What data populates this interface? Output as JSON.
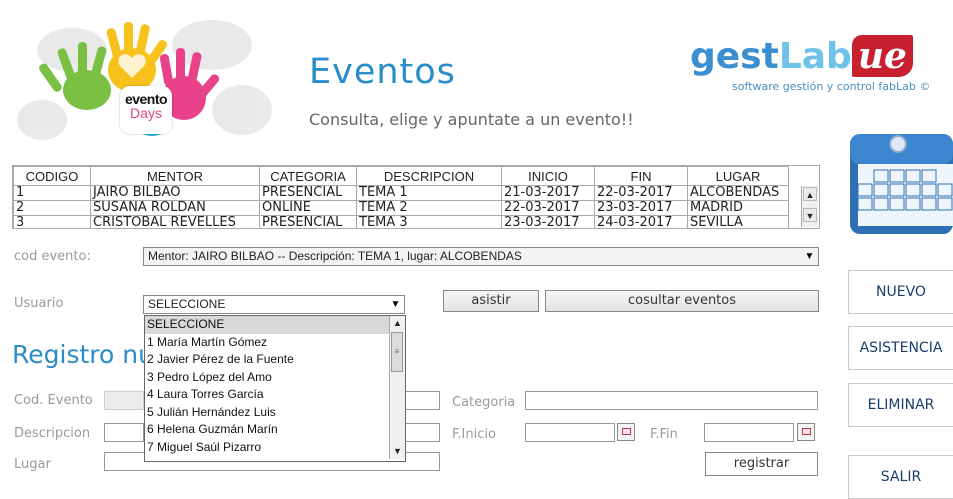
{
  "header": {
    "logo_text_1": "evento",
    "logo_text_2": "Days",
    "title": "Eventos",
    "subtitle": "Consulta, elige y apuntate a un evento!!",
    "brand_part1": "gest",
    "brand_part2": "Lab",
    "brand_part3": "ue",
    "brand_tagline": "software gestión y control fabLab ©"
  },
  "events_table": {
    "columns": [
      "CODIGO",
      "MENTOR",
      "CATEGORIA",
      "DESCRIPCION",
      "INICIO",
      "FIN",
      "LUGAR"
    ],
    "rows": [
      [
        "1",
        "JAIRO BILBAO",
        "PRESENCIAL",
        "TEMA 1",
        "21-03-2017",
        "22-03-2017",
        "ALCOBENDAS"
      ],
      [
        "2",
        "SUSANA ROLDAN",
        "ONLINE",
        "TEMA 2",
        "22-03-2017",
        "23-03-2017",
        "MADRID"
      ],
      [
        "3",
        "CRISTOBAL REVELLES",
        "PRESENCIAL",
        "TEMA 3",
        "23-03-2017",
        "24-03-2017",
        "SEVILLA"
      ]
    ]
  },
  "form": {
    "cod_evento_label": "cod evento:",
    "cod_evento_value": "Mentor: JAIRO BILBAO -- Descripción: TEMA 1, lugar: ALCOBENDAS",
    "usuario_label": "Usuario",
    "usuario_value": "SELECCIONE",
    "asistir_label": "asistir",
    "consultar_label": "cosultar eventos"
  },
  "dropdown": {
    "items": [
      "SELECCIONE",
      "1 María Martín Gómez",
      "2 Javier Pérez de la Fuente",
      "3 Pedro López del Amo",
      "4 Laura Torres García",
      "5 Julián Hernández Luis",
      "6 Helena Guzmán Marín",
      "7 Miguel Saúl Pizarro"
    ]
  },
  "registro": {
    "title": "Registro nu",
    "cod_evento_label": "Cod. Evento",
    "categoria_label": "Categoria",
    "descripcion_label": "Descripcion",
    "finicio_label": "F.Inicio",
    "ffin_label": "F.Fin",
    "lugar_label": "Lugar",
    "registrar_label": "registrar"
  },
  "side_menu": {
    "nuevo": "NUEVO",
    "asistencia": "ASISTENCIA",
    "eliminar": "ELIMINAR",
    "salir": "SALIR"
  },
  "colors": {
    "title_blue": "#2a8cc9",
    "brand_red": "#c8202f",
    "side_text": "#1a3d6e"
  }
}
